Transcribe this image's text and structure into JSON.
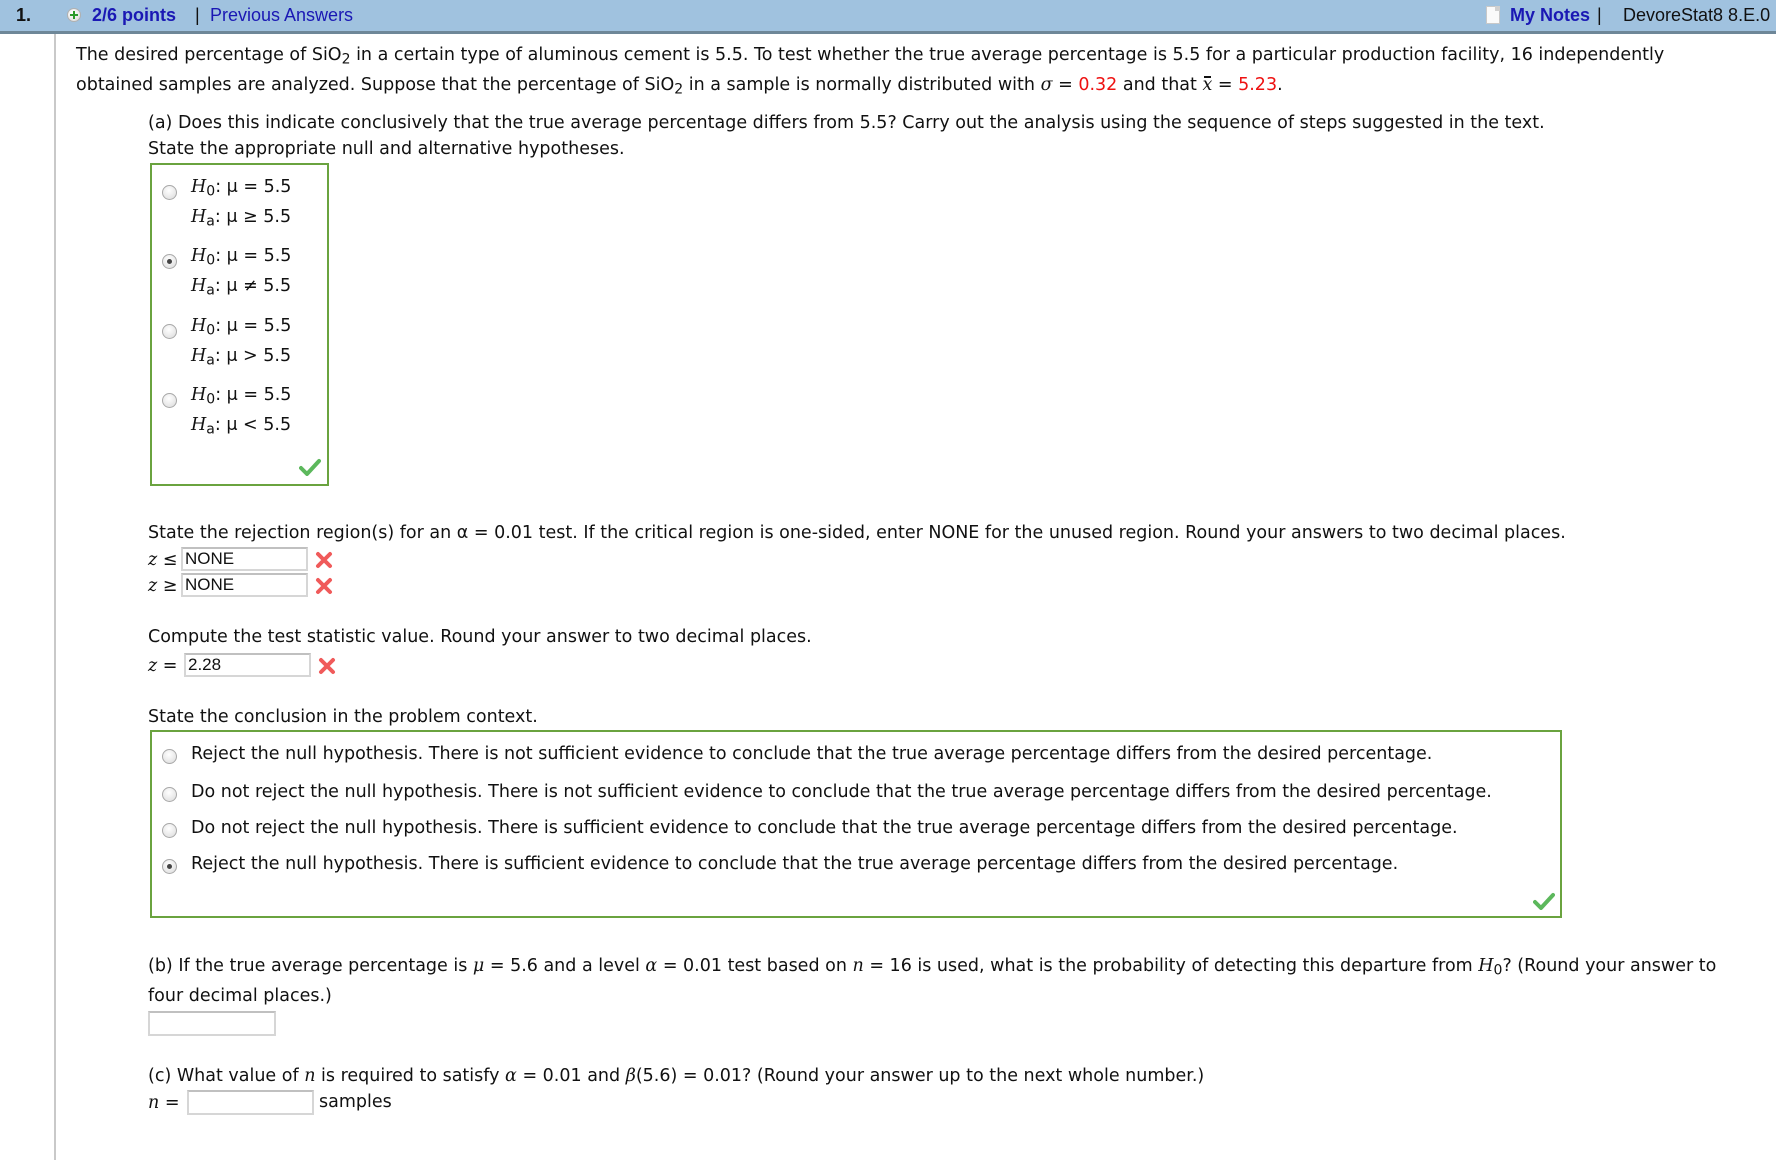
{
  "header": {
    "question_number": "1.",
    "points": "2/6 points",
    "separator": "|",
    "previous_answers": "Previous Answers",
    "my_notes": "My Notes",
    "problem_id": "DevoreStat8 8.E.0"
  },
  "intro": {
    "line1_a": "The desired percentage of SiO",
    "line1_sub": "2",
    "line1_b": " in a certain type of aluminous cement is 5.5. To test whether the true average percentage is 5.5 for a particular production facility, 16 independently",
    "line2_a": "obtained samples are analyzed. Suppose that the percentage of SiO",
    "line2_sub": "2",
    "line2_b": " in a sample is normally distributed with ",
    "sigma_sym": "σ",
    "eq": " = ",
    "sigma_value": "0.32",
    "and_that": " and that ",
    "xbar_sym": "x",
    "xbar_value": "5.23",
    "period": "."
  },
  "part_a": {
    "question": "(a) Does this indicate conclusively that the true average percentage differs from 5.5? Carry out the analysis using the sequence of steps suggested in the text.",
    "prompt": "State the appropriate null and alternative hypotheses.",
    "hypotheses": [
      {
        "h0": "μ = 5.5",
        "ha": "μ ≥ 5.5",
        "selected": false
      },
      {
        "h0": "μ = 5.5",
        "ha": "μ ≠ 5.5",
        "selected": true
      },
      {
        "h0": "μ = 5.5",
        "ha": "μ > 5.5",
        "selected": false
      },
      {
        "h0": "μ = 5.5",
        "ha": "μ < 5.5",
        "selected": false
      }
    ],
    "h0_label": "H",
    "h0_sub": "0",
    "ha_label": "H",
    "ha_sub": "a",
    "hypotheses_status": "correct",
    "rejection_prompt": "State the rejection region(s) for an α = 0.01 test. If the critical region is one-sided, enter NONE for the unused region. Round your answers to two decimal places.",
    "rejection_lower_label": "z ≤",
    "rejection_lower_value": "NONE",
    "rejection_lower_status": "incorrect",
    "rejection_upper_label": "z ≥",
    "rejection_upper_value": "NONE",
    "rejection_upper_status": "incorrect",
    "statistic_prompt": "Compute the test statistic value. Round your answer to two decimal places.",
    "statistic_label": "z =",
    "statistic_value": "2.28",
    "statistic_status": "incorrect",
    "conclusion_prompt": "State the conclusion in the problem context.",
    "conclusions": [
      {
        "text": "Reject the null hypothesis. There is not sufficient evidence to conclude that the true average percentage differs from the desired percentage.",
        "selected": false
      },
      {
        "text": "Do not reject the null hypothesis. There is not sufficient evidence to conclude that the true average percentage differs from the desired percentage.",
        "selected": false
      },
      {
        "text": "Do not reject the null hypothesis. There is sufficient evidence to conclude that the true average percentage differs from the desired percentage.",
        "selected": false
      },
      {
        "text": "Reject the null hypothesis. There is sufficient evidence to conclude that the true average percentage differs from the desired percentage.",
        "selected": true
      }
    ],
    "conclusion_status": "correct"
  },
  "part_b": {
    "q_a": "(b) If the true average percentage is ",
    "mu": "μ",
    "q_b": " = 5.6 and a level ",
    "alpha": "α",
    "q_c": " = 0.01 test based on ",
    "n": "n",
    "q_d": " = 16 is used, what is the probability of detecting this departure from ",
    "h": "H",
    "h_sub": "0",
    "q_e": "? (Round your answer to",
    "line2": "four decimal places.)",
    "answer_value": ""
  },
  "part_c": {
    "q_a": "(c) What value of ",
    "n": "n",
    "q_b": " is required to satisfy ",
    "alpha": "α",
    "q_c": " = 0.01 and ",
    "beta": "β",
    "q_d": "(5.6) = 0.01? (Round your answer up to the next whole number.)",
    "n_label": "n",
    "eq": " =",
    "answer_value": "",
    "unit": "samples"
  }
}
